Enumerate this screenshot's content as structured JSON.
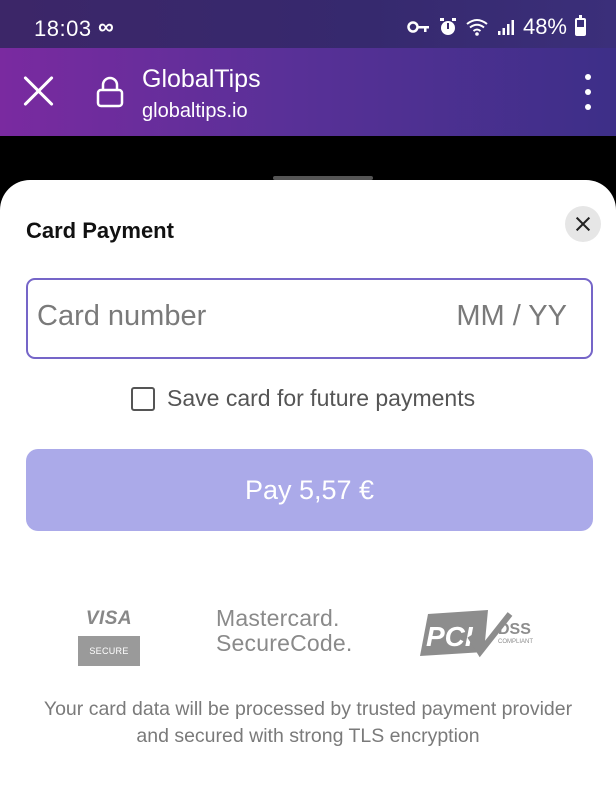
{
  "status_bar": {
    "time": "18:03",
    "infinity_glyph": "∞",
    "battery": "48%",
    "icons": [
      "key-icon",
      "alarm-icon",
      "wifi-icon",
      "signal-icon",
      "battery-icon"
    ]
  },
  "browser": {
    "site_title": "GlobalTips",
    "site_domain": "globaltips.io"
  },
  "sheet": {
    "title": "Card Payment",
    "card_number_placeholder": "Card number",
    "expiry_placeholder": "MM / YY",
    "save_card_label": "Save card for future payments",
    "pay_button_label": "Pay 5,57 €",
    "footer_text": "Your card data will be processed by trusted payment provider and secured with strong TLS encryption"
  },
  "logos": {
    "visa": "VISA",
    "visa_secure": "SECURE",
    "mastercard_line1": "Mastercard.",
    "mastercard_line2": "SecureCode.",
    "pci": "PCI",
    "dss": "DSS",
    "compliant": "COMPLIANT"
  },
  "colors": {
    "accent_border": "#7565c8",
    "pay_button_disabled": "#abaae9",
    "browser_bar_start": "#7a2aa0",
    "browser_bar_end": "#3d2f88"
  }
}
